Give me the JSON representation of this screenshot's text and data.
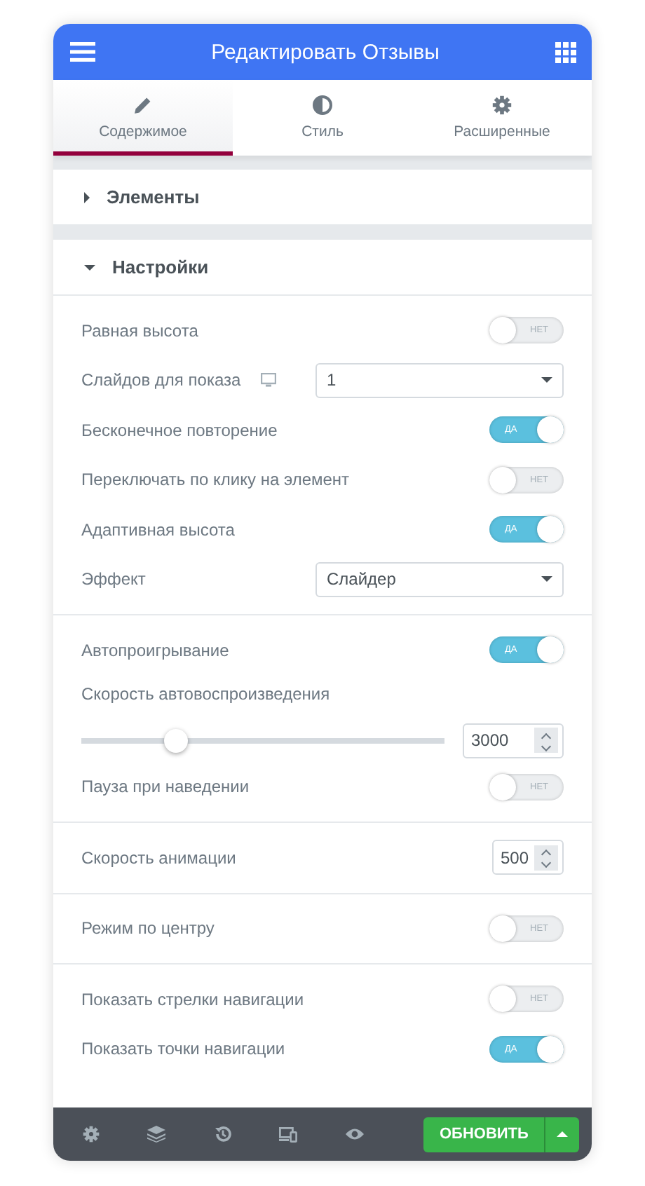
{
  "header": {
    "title": "Редактировать Отзывы"
  },
  "tabs": [
    {
      "label": "Содержимое",
      "selected": true
    },
    {
      "label": "Стиль",
      "selected": false
    },
    {
      "label": "Расширенные",
      "selected": false
    }
  ],
  "sections": [
    {
      "title": "Элементы",
      "expanded": false
    },
    {
      "title": "Настройки",
      "expanded": true
    }
  ],
  "groups": [
    {
      "controls": [
        {
          "kind": "switch",
          "label": "Равная высота",
          "on": false,
          "switch_text": "НЕТ"
        },
        {
          "kind": "select",
          "label": "Слайдов для показа",
          "responsive": true,
          "value": "1"
        },
        {
          "kind": "switch",
          "label": "Бесконечное повторение",
          "on": true,
          "switch_text": "ДА"
        },
        {
          "kind": "switch",
          "label": "Переключать по клику на элемент",
          "on": false,
          "switch_text": "НЕТ"
        },
        {
          "kind": "switch",
          "label": "Адаптивная высота",
          "on": true,
          "switch_text": "ДА"
        },
        {
          "kind": "select",
          "label": "Эффект",
          "responsive": false,
          "value": "Слайдер"
        }
      ]
    },
    {
      "controls": [
        {
          "kind": "switch",
          "label": "Автопроигрывание",
          "on": true,
          "switch_text": "ДА"
        },
        {
          "kind": "slider",
          "label": "Скорость автовоспроизведения",
          "level": 0.26,
          "value": "3000"
        },
        {
          "kind": "switch",
          "label": "Пауза при наведении",
          "on": false,
          "switch_text": "НЕТ"
        }
      ]
    },
    {
      "controls": [
        {
          "kind": "number",
          "label": "Скорость анимации",
          "value": "500"
        }
      ]
    },
    {
      "controls": [
        {
          "kind": "switch",
          "label": "Режим по центру",
          "on": false,
          "switch_text": "НЕТ"
        }
      ]
    },
    {
      "controls": [
        {
          "kind": "switch",
          "label": "Показать стрелки навигации",
          "on": false,
          "switch_text": "НЕТ"
        },
        {
          "kind": "switch",
          "label": "Показать точки навигации",
          "on": true,
          "switch_text": "ДА"
        }
      ]
    }
  ],
  "footer": {
    "update_button": "ОБНОВИТЬ"
  }
}
